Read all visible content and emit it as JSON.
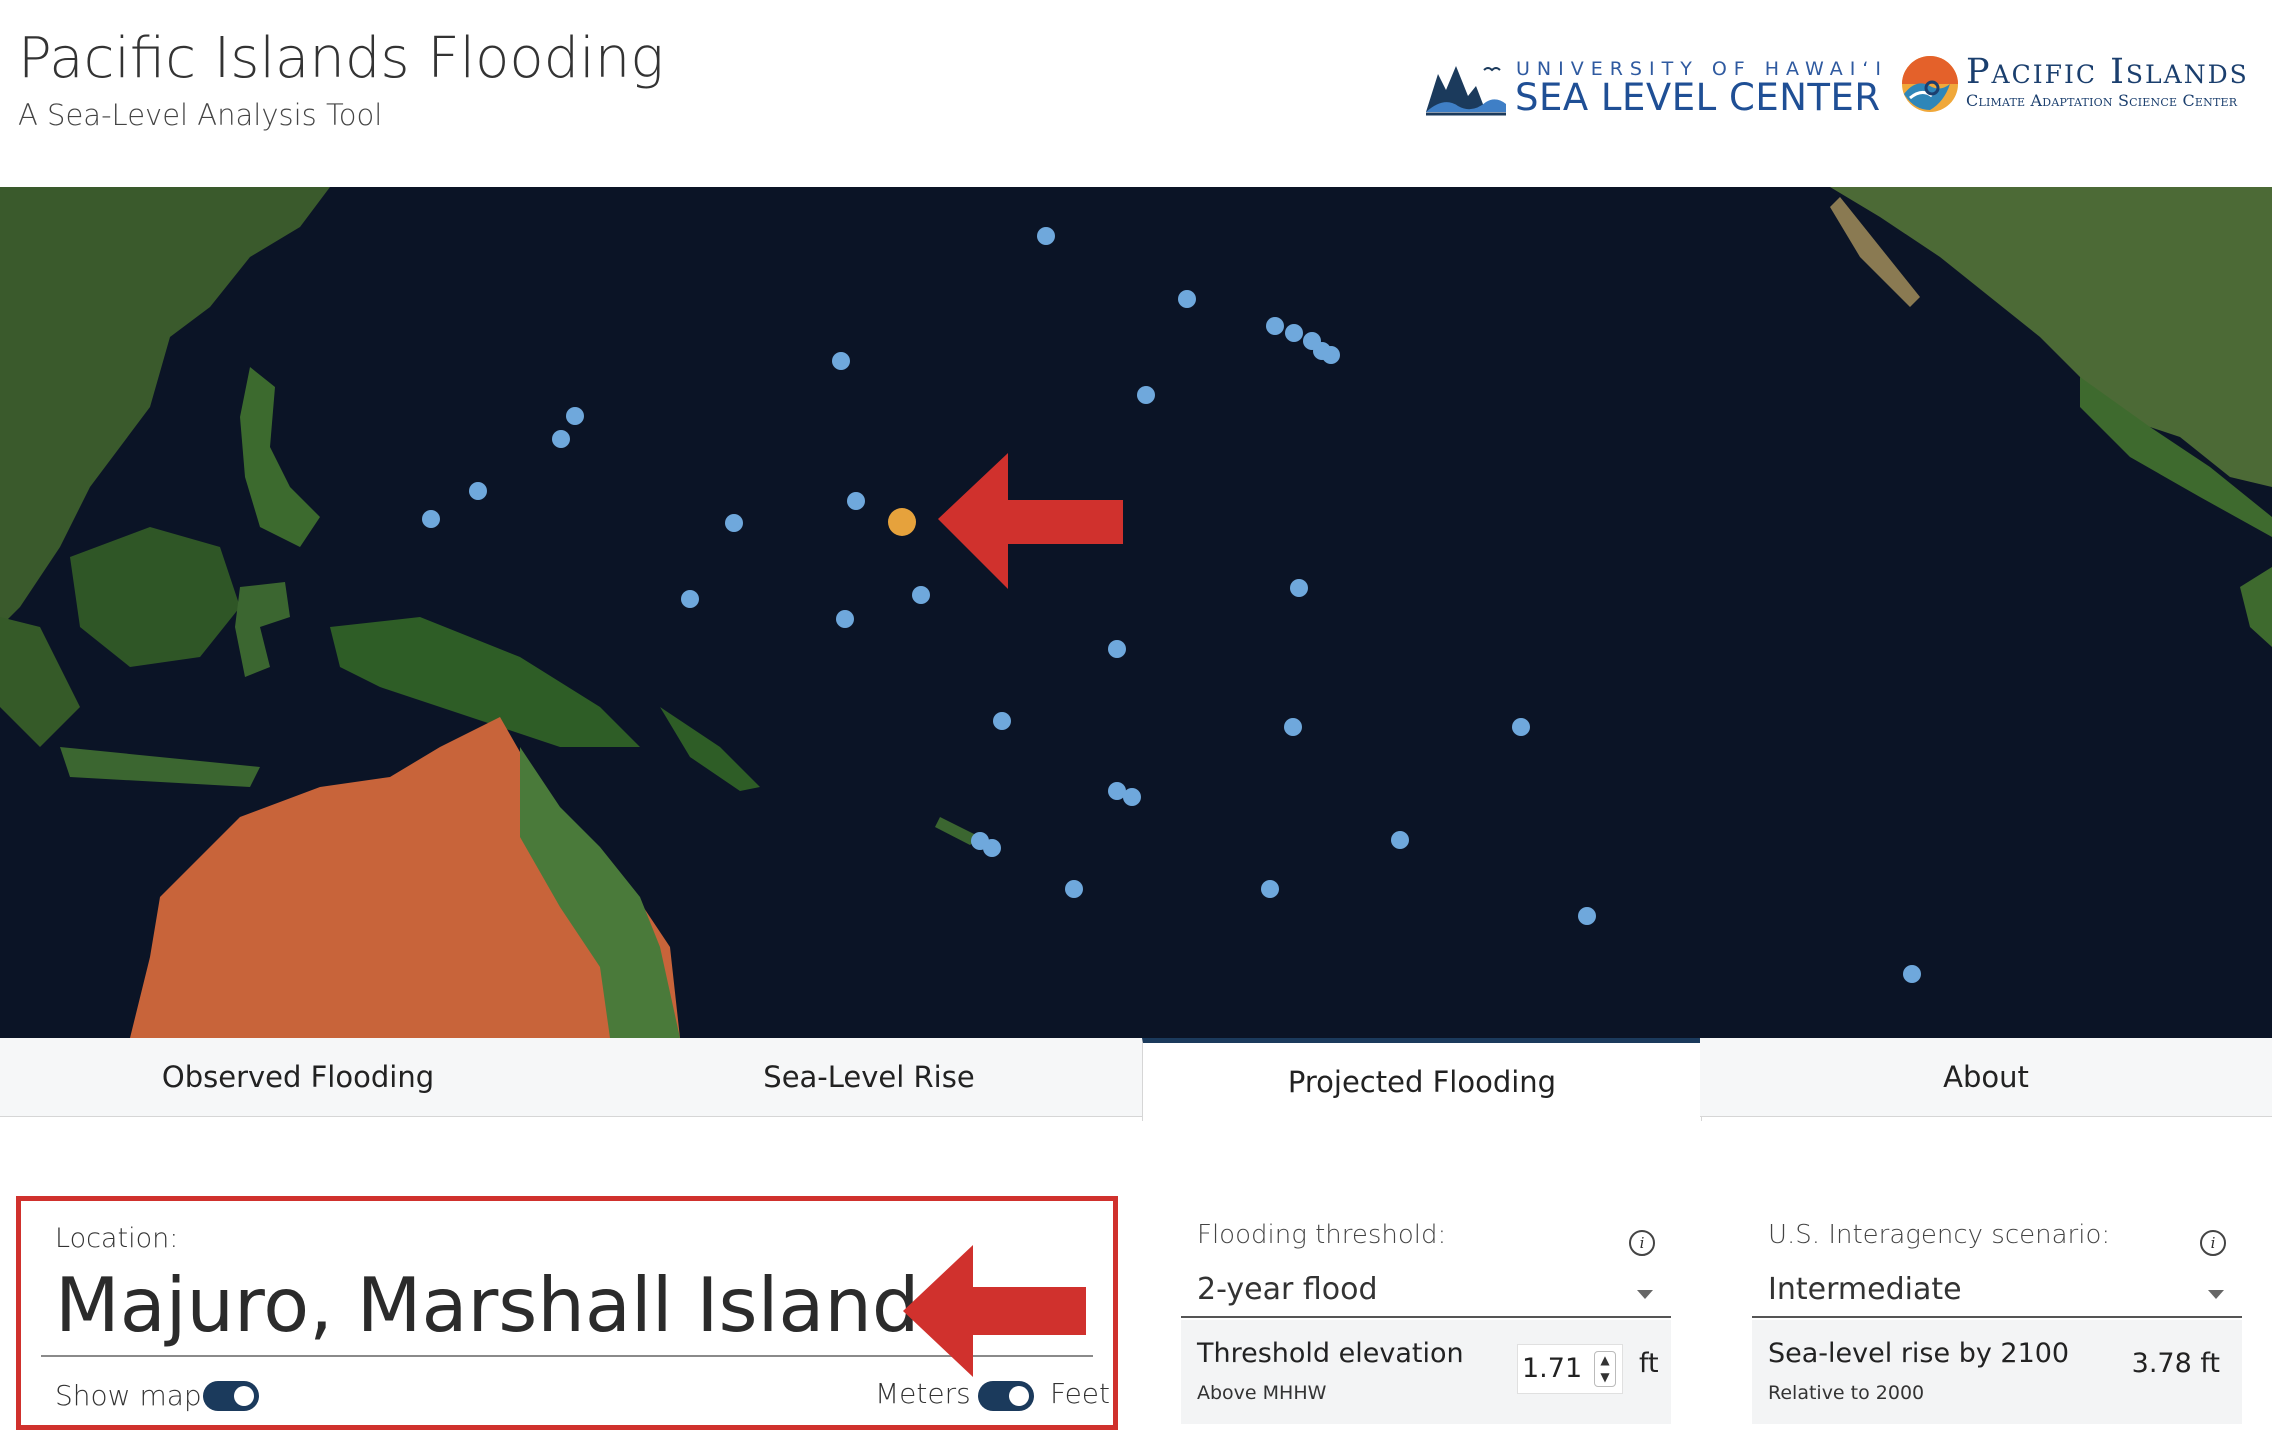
{
  "header": {
    "title": "Pacific Islands Flooding",
    "subtitle": "A Sea-Level Analysis Tool",
    "slc_logo": {
      "line1": "UNIVERSITY OF HAWAIʻI",
      "line2": "SEA LEVEL CENTER",
      "icon": "wave-mountain-icon"
    },
    "pic_logo": {
      "line1": "Pacific Islands",
      "line2": "Climate Adaptation Science Center",
      "icon": "swirl-wave-icon"
    }
  },
  "colors": {
    "accent": "#1b3a5c",
    "highlight": "#d0312d",
    "station": "#6fa8dc",
    "selected_station": "#e6a23c",
    "ocean": "#0b1426"
  },
  "map": {
    "stations_count": 36,
    "selected_station": "Majuro, Marshall Islands"
  },
  "tabs": [
    {
      "label": "Observed Flooding",
      "active": false
    },
    {
      "label": "Sea-Level Rise",
      "active": false
    },
    {
      "label": "Projected Flooding",
      "active": true
    },
    {
      "label": "About",
      "active": false
    }
  ],
  "location": {
    "label": "Location:",
    "name": "Majuro, Marshall Islands",
    "show_map_label": "Show map",
    "show_map_on": true,
    "unit_left": "Meters",
    "unit_right": "Feet",
    "unit_is_feet": true
  },
  "threshold": {
    "label": "Flooding threshold:",
    "selected": "2-year flood",
    "elevation_title": "Threshold elevation",
    "elevation_sub": "Above MHHW",
    "elevation_value": "1.71",
    "elevation_unit": "ft",
    "info_icon": "info-icon"
  },
  "scenario": {
    "label": "U.S. Interagency scenario:",
    "selected": "Intermediate",
    "slr_title": "Sea-level rise by 2100",
    "slr_sub": "Relative to 2000",
    "slr_value": "3.78 ft",
    "info_icon": "info-icon"
  }
}
